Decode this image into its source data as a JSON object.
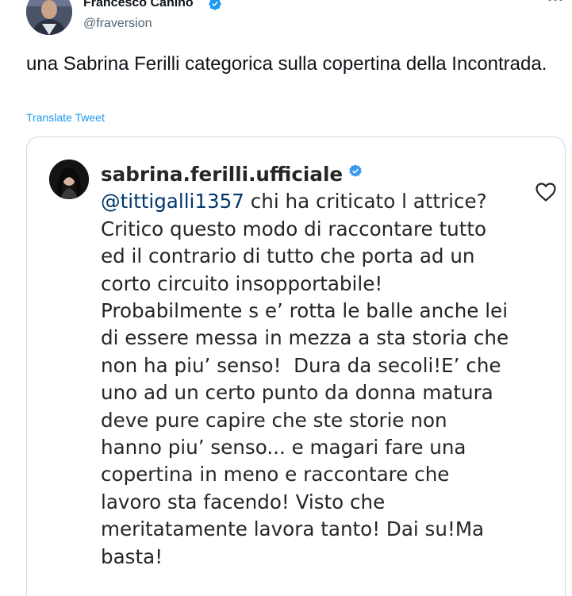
{
  "tweet": {
    "author": {
      "name": "Francesco Canino",
      "handle": "@fraversion"
    },
    "text": "una Sabrina Ferilli categorica sulla copertina della Incontrada.",
    "translate_label": "Translate Tweet",
    "more_icon": "more-horizontal-icon"
  },
  "embedded_post": {
    "username": "sabrina.ferilli.ufficiale",
    "mention": "@tittigalli1357",
    "text_after_mention": " chi ha criticato l attrice? Critico questo modo di raccontare tutto ed il contrario di tutto che porta ad un corto circuito insopportabile! Probabilmente s e’ rotta le balle anche lei di essere messa in mezza a sta storia che non ha piu’ senso!  Dura da secoli!E’ che uno ad un certo punto da donna matura deve pure capire che ste storie non hanno piu’ senso... e magari fare una copertina in meno e raccontare che lavoro sta facendo! Visto che meritatamente lavora tanto! Dai su!Ma basta!",
    "like_icon": "heart-outline-icon"
  },
  "colors": {
    "verified": "#1d9bf0",
    "instagram_verified": "#3897f0",
    "link": "#1d9bf0",
    "mention": "#00376b",
    "secondary_text": "#536471",
    "border": "#cfd9de"
  }
}
